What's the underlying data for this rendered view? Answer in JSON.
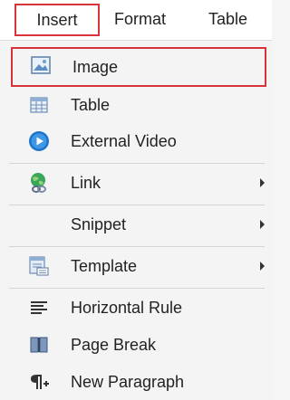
{
  "menubar": {
    "items": [
      {
        "label": "Insert"
      },
      {
        "label": "Format"
      },
      {
        "label": "Table"
      }
    ]
  },
  "menu": {
    "items": [
      {
        "label": "Image",
        "icon": "image-icon",
        "submenu": false
      },
      {
        "label": "Table",
        "icon": "table-icon",
        "submenu": false
      },
      {
        "label": "External Video",
        "icon": "video-play-icon",
        "submenu": false
      },
      {
        "label": "Link",
        "icon": "link-globe-icon",
        "submenu": true
      },
      {
        "label": "Snippet",
        "icon": "",
        "submenu": true
      },
      {
        "label": "Template",
        "icon": "template-icon",
        "submenu": true
      },
      {
        "label": "Horizontal Rule",
        "icon": "horizontal-rule-icon",
        "submenu": false
      },
      {
        "label": "Page Break",
        "icon": "page-break-icon",
        "submenu": false
      },
      {
        "label": "New Paragraph",
        "icon": "new-paragraph-icon",
        "submenu": false
      }
    ]
  },
  "colors": {
    "highlight_border": "#d8343a",
    "menu_background": "#f4f4f4",
    "menubar_background": "#ffffff",
    "separator": "#d4d4d4"
  }
}
